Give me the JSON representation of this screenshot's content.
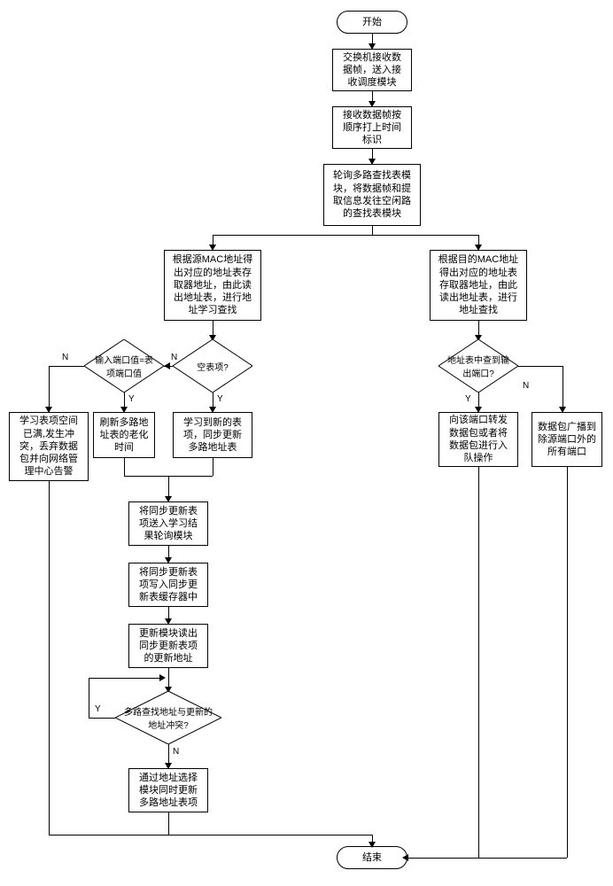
{
  "terminals": {
    "start": "开始",
    "end": "结束"
  },
  "processes": {
    "p1": "交换机接收数据帧，送入接收调度模块",
    "p2": "接收数据帧按顺序打上时间标识",
    "p3": "轮询多路查找表模块，将数据帧和提取信息发往空闲路的查找表模块",
    "p4_left": "根据源MAC地址得出对应的地址表存取器地址，由此读出地址表，进行地址学习查找",
    "p4_right": "根据目的MAC地址得出对应的地址表存取器地址，由此读出地址表，进行地址查找",
    "p5": "学习表项空间已满,发生冲突，丢弃数据包并向网络管理中心告警",
    "p6": "刷新多路地址表的老化时间",
    "p7": "学习到新的表项，同步更新多路地址表",
    "p8": "向该端口转发数据包或者将数据包进行入队操作",
    "p9": "数据包广播到除源端口外的所有端口",
    "p10": "将同步更新表项送入学习结果轮询模块",
    "p11": "将同步更新表项写入同步更新表缓存器中",
    "p12": "更新模块读出同步更新表项的更新地址",
    "p13": "通过地址选择模块同时更新多路地址表项"
  },
  "decisions": {
    "d1": "空表项?",
    "d2": "输入端口值=表项端口值",
    "d3": "地址表中查到输出端口?",
    "d4": "多路查找地址与更新的地址冲突?"
  },
  "labels": {
    "yes": "Y",
    "no": "N"
  }
}
